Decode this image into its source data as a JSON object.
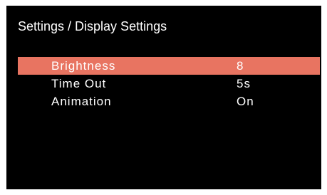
{
  "screen": {
    "title": "Settings / Display Settings",
    "background": "#000000",
    "accent": "#e87461",
    "items": [
      {
        "label": "Brightness",
        "value": "8",
        "selected": true
      },
      {
        "label": "Time Out",
        "value": "5s",
        "selected": false
      },
      {
        "label": "Animation",
        "value": "On",
        "selected": false
      }
    ]
  }
}
